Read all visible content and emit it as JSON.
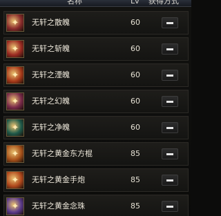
{
  "header": {
    "name_label": "名称",
    "lv_label": "Lv",
    "obtain_label": "获得方式"
  },
  "items": [
    {
      "name": "无轩之散魄",
      "level": "60",
      "icon": "soul-red-icon",
      "color": "#8a2c2c"
    },
    {
      "name": "无轩之斩魄",
      "level": "60",
      "icon": "soul-red-icon",
      "color": "#9a2a22"
    },
    {
      "name": "无轩之湮魄",
      "level": "60",
      "icon": "soul-orange-icon",
      "color": "#a83a1a"
    },
    {
      "name": "无轩之幻魄",
      "level": "60",
      "icon": "soul-purple-icon",
      "color": "#7a2a4a"
    },
    {
      "name": "无轩之净魄",
      "level": "60",
      "icon": "soul-teal-icon",
      "color": "#1f5a4a"
    },
    {
      "name": "无轩之黄金东方棍",
      "level": "85",
      "icon": "staff-icon",
      "color": "#a8521a"
    },
    {
      "name": "无轩之黄金手炮",
      "level": "85",
      "icon": "cannon-icon",
      "color": "#b0481c"
    },
    {
      "name": "无轩之黄金念珠",
      "level": "85",
      "icon": "beads-icon",
      "color": "#5a3a8a"
    }
  ]
}
